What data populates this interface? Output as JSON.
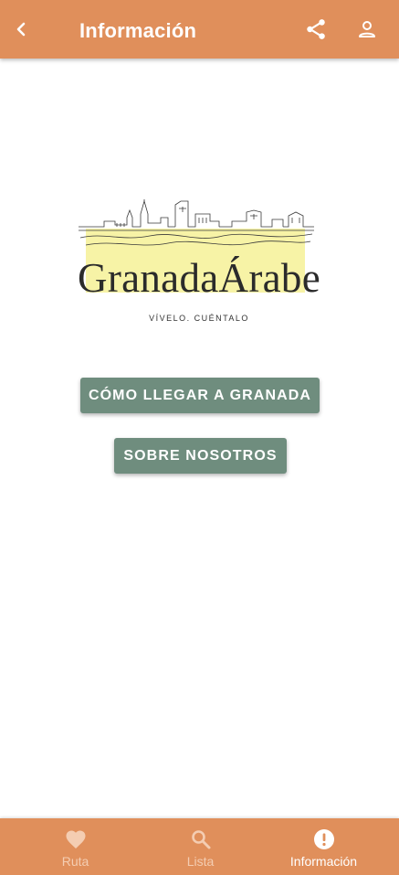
{
  "app_bar": {
    "title": "Información",
    "icons": [
      "back-arrow-icon",
      "share-icon",
      "account-icon"
    ]
  },
  "logo": {
    "brand": "GranadaÁrabe",
    "tagline": "VÍVELO. CUÉNTALO"
  },
  "buttons": {
    "como_llegar": "CÓMO LLEGAR A GRANADA",
    "sobre_nosotros": "SOBRE NOSOTROS"
  },
  "bottom_nav": {
    "items": [
      {
        "label": "Ruta",
        "icon": "heart-icon",
        "active": false
      },
      {
        "label": "Lista",
        "icon": "search-icon",
        "active": false
      },
      {
        "label": "Información",
        "icon": "info-alert-icon",
        "active": true
      }
    ]
  },
  "colors": {
    "primary": "#e08f5b",
    "button": "#6f8d7e",
    "highlight": "#f7f3a6",
    "inactive_nav": "#f4cdb2"
  }
}
